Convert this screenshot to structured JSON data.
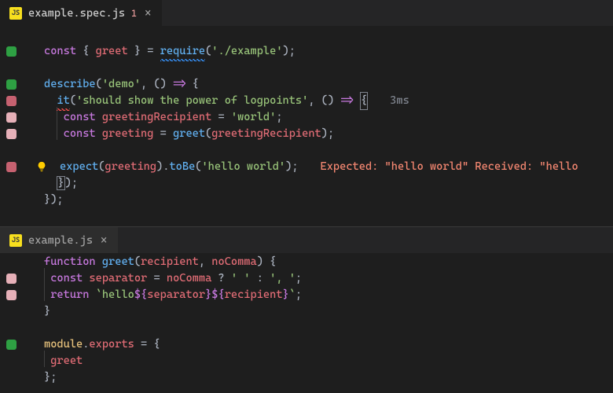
{
  "panes": [
    {
      "tab": {
        "icon": "JS",
        "filename": "example.spec.js",
        "badge": "1",
        "close": "×"
      },
      "code": {
        "l1": "const { greet } = require('./example');",
        "l2_a": "describe('demo', () => {",
        "l3_a": "  it('should show the power of logpoints', () => ",
        "l3_brace": "{",
        "l3_hint": "3ms",
        "l4": "    const greetingRecipient = 'world';",
        "l5": "    const greeting = greet(greetingRecipient);",
        "l6": "    expect(greeting).toBe('hello world');",
        "l6_err": "Expected: \"hello world\" Received: \"hello",
        "l7": "  });",
        "l8": "});"
      }
    },
    {
      "tab": {
        "icon": "JS",
        "filename": "example.js",
        "close": "×"
      },
      "code": {
        "l1": "function greet(recipient, noComma) {",
        "l2": "  const separator = noComma ? ' ' : ', ';",
        "l3": "  return `hello${separator}${recipient}`;",
        "l4": "}",
        "l5": "module.exports = {",
        "l6": "  greet",
        "l7": "};"
      }
    }
  ]
}
